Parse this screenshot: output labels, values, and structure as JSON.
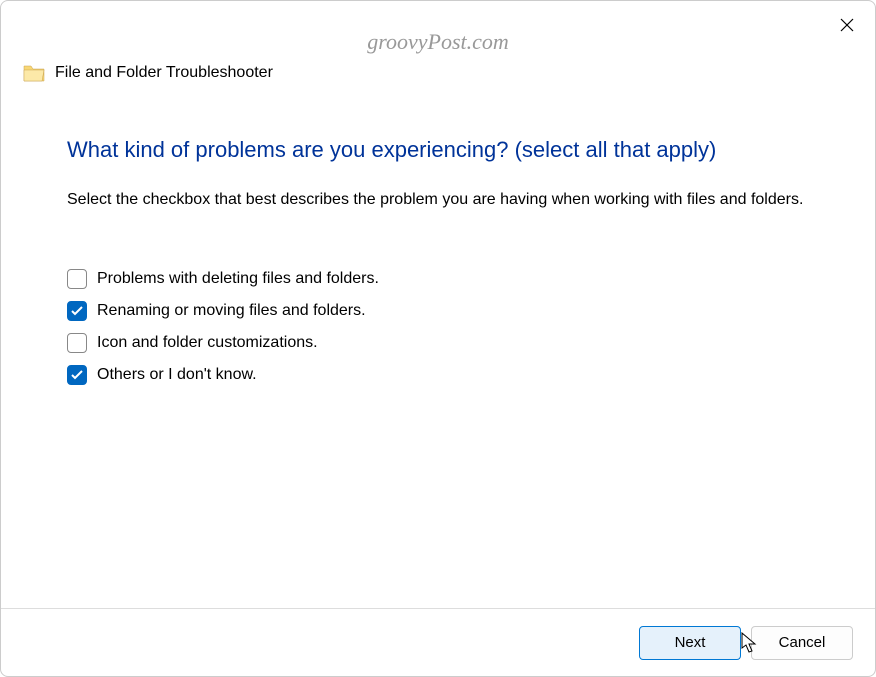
{
  "watermark": "groovyPost.com",
  "header": {
    "title": "File and Folder Troubleshooter"
  },
  "main": {
    "heading": "What kind of problems are you experiencing? (select all that apply)",
    "description": "Select the checkbox that best describes the problem you are having when working with files and folders.",
    "options": [
      {
        "label": "Problems with deleting files and folders.",
        "checked": false
      },
      {
        "label": "Renaming or moving files and folders.",
        "checked": true
      },
      {
        "label": "Icon and folder customizations.",
        "checked": false
      },
      {
        "label": "Others or I don't know.",
        "checked": true
      }
    ]
  },
  "footer": {
    "next_label": "Next",
    "cancel_label": "Cancel"
  }
}
